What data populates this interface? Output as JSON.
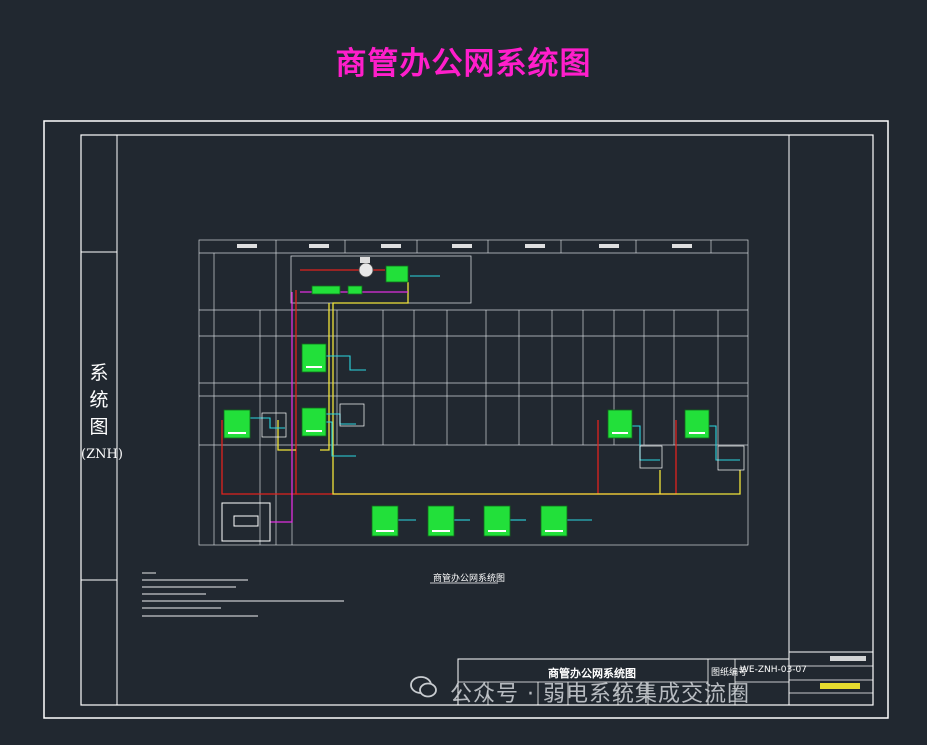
{
  "title": "商管办公网系统图",
  "side_label": [
    "系",
    "统",
    "图",
    "(ZNH)"
  ],
  "drawing_caption": "商管办公网系统图",
  "title_block": {
    "drawing_name": "商管办公网系统图",
    "drawing_no_label": "图纸编号",
    "drawing_no": "WE-ZNH-03-07"
  },
  "watermark": "公众号 · 弱电系统集成交流圈",
  "colors": {
    "background": "#212830",
    "title": "#ff1ecb",
    "frame": "#ffffff",
    "device": "#22e03a",
    "link_red": "#e0231e",
    "link_yellow": "#f0e33a",
    "link_magenta": "#e02ee0",
    "link_cyan": "#2ad6e0"
  },
  "icons": [
    "wechat-icon",
    "network-switch-icon",
    "workstation-icon"
  ]
}
